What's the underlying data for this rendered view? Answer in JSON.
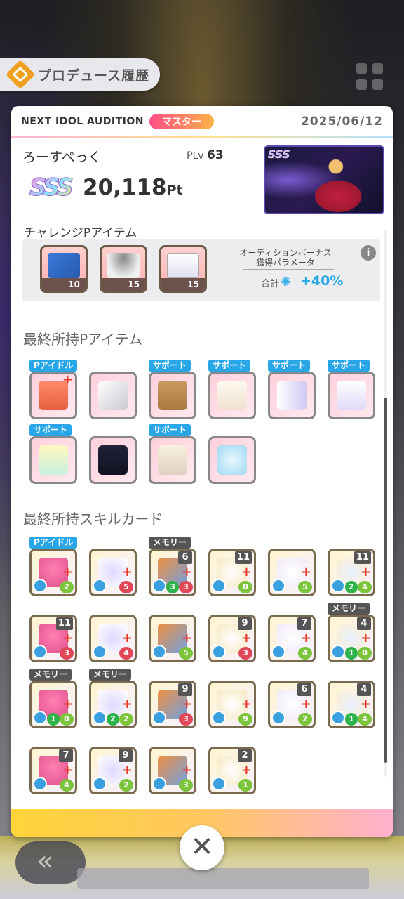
{
  "header": {
    "title": "プロデュース履歴"
  },
  "card": {
    "audition": "NEXT IDOL AUDITION",
    "rank": "マスター",
    "date": "2025/06/12",
    "player_name": "ろーすぺっく",
    "plv_label": "PLv",
    "plv_value": "63",
    "grade": "SSS",
    "score": "20,118",
    "score_unit": "Pt",
    "thumb_grade": "SSS"
  },
  "challenge": {
    "title": "チャレンジPアイテム",
    "items": [
      {
        "icon": "blue-folder-icon",
        "value": "10"
      },
      {
        "icon": "umbrella-icon",
        "value": "15"
      },
      {
        "icon": "tote-bag-icon",
        "value": "15"
      }
    ],
    "bonus_label_1": "オーディションボーナス",
    "bonus_label_2": "獲得パラメータ",
    "total_label": "合計",
    "total_value": "+40%",
    "info": "i"
  },
  "final_items": {
    "title": "最終所持Pアイテム",
    "items": [
      {
        "ribbon": "Pアイドル",
        "icon": "knit-hat-icon"
      },
      {
        "ribbon": "",
        "icon": "towel-pack-icon"
      },
      {
        "ribbon": "サポート",
        "icon": "cardboard-box-icon"
      },
      {
        "ribbon": "サポート",
        "icon": "notebook-icon"
      },
      {
        "ribbon": "サポート",
        "icon": "drink-can-icon"
      },
      {
        "ribbon": "サポート",
        "icon": "flower-tag-icon"
      },
      {
        "ribbon": "サポート",
        "icon": "flower-jar-icon"
      },
      {
        "ribbon": "",
        "icon": "black-bag-icon"
      },
      {
        "ribbon": "サポート",
        "icon": "clipboard-icon"
      },
      {
        "ribbon": "",
        "icon": "snow-globe-icon"
      }
    ]
  },
  "skill_cards": {
    "title": "最終所持スキルカード",
    "cards": [
      {
        "ribbon": "Pアイドル",
        "cost": "",
        "bottom": "2",
        "heart_color": "green"
      },
      {
        "ribbon": "",
        "cost": "",
        "bottom": "5",
        "heart_color": "red"
      },
      {
        "ribbon": "メモリー",
        "cost": "6",
        "bottom": "3",
        "heart_color": "red",
        "left_num": "3"
      },
      {
        "ribbon": "",
        "cost": "11",
        "bottom": "0",
        "heart_color": "green"
      },
      {
        "ribbon": "",
        "cost": "",
        "bottom": "5",
        "heart_color": "green"
      },
      {
        "ribbon": "",
        "cost": "11",
        "bottom": "4",
        "heart_color": "green",
        "left_num": "2"
      },
      {
        "ribbon": "",
        "cost": "11",
        "bottom": "3",
        "heart_color": "red"
      },
      {
        "ribbon": "",
        "cost": "",
        "bottom": "4",
        "heart_color": "red"
      },
      {
        "ribbon": "",
        "cost": "",
        "bottom": "5",
        "heart_color": "green"
      },
      {
        "ribbon": "",
        "cost": "9",
        "bottom": "3",
        "heart_color": "red"
      },
      {
        "ribbon": "",
        "cost": "7",
        "bottom": "4",
        "heart_color": "green"
      },
      {
        "ribbon": "メモリー",
        "cost": "4",
        "bottom": "0",
        "heart_color": "green",
        "left_num": "1"
      },
      {
        "ribbon": "メモリー",
        "cost": "",
        "bottom": "0",
        "heart_color": "green",
        "left_num": "1"
      },
      {
        "ribbon": "メモリー",
        "cost": "",
        "bottom": "2",
        "heart_color": "green",
        "left_num": "2"
      },
      {
        "ribbon": "",
        "cost": "9",
        "bottom": "3",
        "heart_color": "red"
      },
      {
        "ribbon": "",
        "cost": "",
        "bottom": "9",
        "heart_color": "green"
      },
      {
        "ribbon": "",
        "cost": "6",
        "bottom": "2",
        "heart_color": "green"
      },
      {
        "ribbon": "",
        "cost": "4",
        "bottom": "4",
        "heart_color": "green",
        "left_num": "1"
      },
      {
        "ribbon": "",
        "cost": "7",
        "bottom": "4",
        "heart_color": "green"
      },
      {
        "ribbon": "",
        "cost": "9",
        "bottom": "2",
        "heart_color": "green"
      },
      {
        "ribbon": "",
        "cost": "",
        "bottom": "3",
        "heart_color": "green"
      },
      {
        "ribbon": "",
        "cost": "2",
        "bottom": "1",
        "heart_color": "green"
      }
    ]
  },
  "close": "✕",
  "back": "«"
}
